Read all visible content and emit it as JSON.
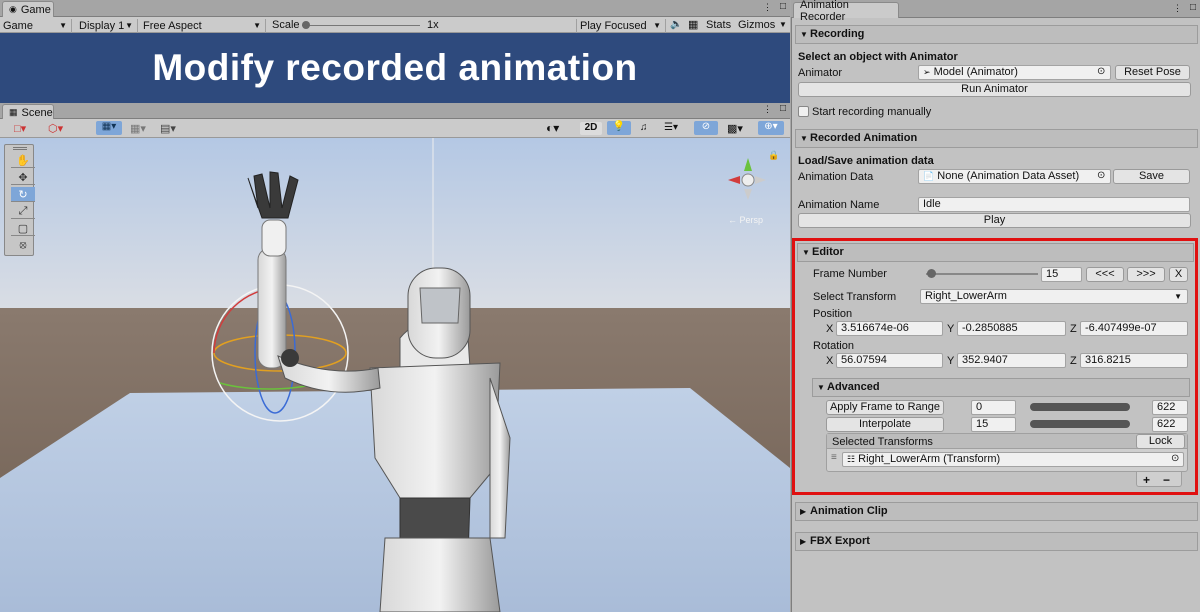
{
  "game": {
    "tab": "Game",
    "display_mode": "Game",
    "display": "Display 1",
    "aspect": "Free Aspect",
    "scale_label": "Scale",
    "scale_value": "1x",
    "play_mode": "Play Focused",
    "stats": "Stats",
    "gizmos": "Gizmos",
    "banner": "Modify recorded animation"
  },
  "scene": {
    "tab": "Scene",
    "mode_2d": "2D",
    "gizmo_label": "← Persp"
  },
  "recorder": {
    "tab": "Animation Recorder",
    "recording": {
      "header": "Recording",
      "select_title": "Select an object with Animator",
      "animator_label": "Animator",
      "animator_value": "Model (Animator)",
      "reset_pose": "Reset Pose",
      "run_animator": "Run Animator",
      "start_manual": "Start recording manually"
    },
    "recorded": {
      "header": "Recorded Animation",
      "load_save_title": "Load/Save animation data",
      "data_label": "Animation Data",
      "data_value": "None (Animation Data Asset)",
      "save": "Save",
      "name_label": "Animation Name",
      "name_value": "Idle",
      "play": "Play"
    },
    "editor": {
      "header": "Editor",
      "frame_label": "Frame Number",
      "frame_value": "15",
      "frame_fraction": 0.024,
      "prev": "<<<",
      "next": ">>>",
      "close": "X",
      "select_label": "Select Transform",
      "select_value": "Right_LowerArm",
      "position_label": "Position",
      "position": {
        "x": "3.516674e-06",
        "y": "-0.2850885",
        "z": "-6.407499e-07"
      },
      "rotation_label": "Rotation",
      "rotation": {
        "x": "56.07594",
        "y": "352.9407",
        "z": "316.8215"
      },
      "axis_x": "X",
      "axis_y": "Y",
      "axis_z": "Z",
      "advanced": {
        "header": "Advanced",
        "apply_range": "Apply Frame to Range",
        "range_min": "0",
        "range_max": "622",
        "interpolate": "Interpolate",
        "interp_min": "15",
        "interp_max": "622",
        "selected_header": "Selected Transforms",
        "lock": "Lock",
        "item": "Right_LowerArm (Transform)",
        "add": "+",
        "remove": "−"
      }
    },
    "clip": {
      "header": "Animation Clip"
    },
    "fbx": {
      "header": "FBX Export"
    }
  },
  "colors": {
    "banner_bg": "#2e4a7d",
    "highlight": "#e01010",
    "sky": "#c9d4e2",
    "ground": "#b6c7e0"
  }
}
